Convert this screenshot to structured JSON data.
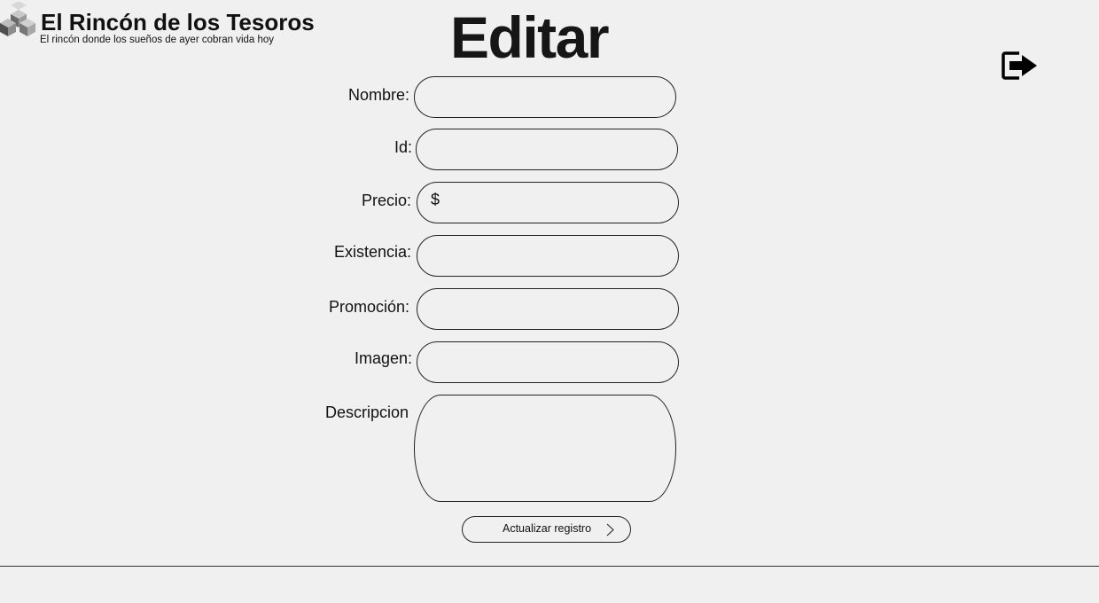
{
  "brand": {
    "title": "El Rincón de los Tesoros",
    "subtitle": "El rincón donde los sueños de ayer cobran vida hoy",
    "logo_icon": "stacked-cubes-icon"
  },
  "page": {
    "title": "Editar"
  },
  "header": {
    "logout_icon": "logout-icon"
  },
  "form": {
    "name_label": "Nombre:",
    "name_value": "",
    "id_label": "Id:",
    "id_value": "",
    "price_label": "Precio:",
    "price_prefix": "$",
    "price_value": "",
    "stock_label": "Existencia:",
    "stock_value": "",
    "promo_label": "Promoción:",
    "promo_value": "",
    "image_label": "Imagen:",
    "image_value": "",
    "description_label": "Descripcion",
    "description_value": "",
    "submit_label": "Actualizar registro",
    "submit_icon": "chevron-right-icon"
  },
  "colors": {
    "background": "#f0f0f0",
    "text": "#111111",
    "border": "#222222",
    "logo_dark": "#555555",
    "logo_light": "#b8b8b8"
  }
}
